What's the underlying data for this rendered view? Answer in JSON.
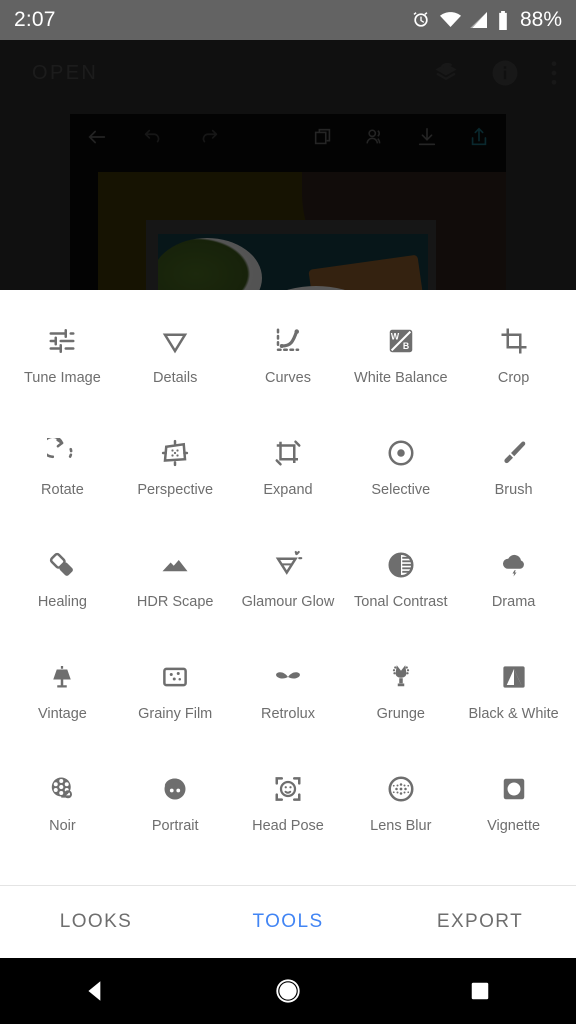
{
  "status_bar": {
    "time": "2:07",
    "battery_percent": "88%",
    "icons": [
      "alarm-icon",
      "wifi-icon",
      "cell-signal-icon",
      "battery-icon"
    ]
  },
  "app_bar": {
    "title": "OPEN",
    "icons": [
      "stack-layers-icon",
      "info-icon",
      "overflow-menu-icon"
    ]
  },
  "editor_toolbar": {
    "icons": [
      "back-arrow-icon",
      "undo-icon",
      "redo-icon",
      "stack-copies-icon",
      "portrait-people-icon",
      "download-icon",
      "share-export-icon"
    ]
  },
  "sheet": {
    "tools": [
      {
        "label": "Tune Image",
        "icon": "tune-sliders-icon"
      },
      {
        "label": "Details",
        "icon": "details-triangle-icon"
      },
      {
        "label": "Curves",
        "icon": "curves-icon"
      },
      {
        "label": "White Balance",
        "icon": "white-balance-icon"
      },
      {
        "label": "Crop",
        "icon": "crop-icon"
      },
      {
        "label": "Rotate",
        "icon": "rotate-icon"
      },
      {
        "label": "Perspective",
        "icon": "perspective-icon"
      },
      {
        "label": "Expand",
        "icon": "expand-icon"
      },
      {
        "label": "Selective",
        "icon": "selective-target-icon"
      },
      {
        "label": "Brush",
        "icon": "brush-icon"
      },
      {
        "label": "Healing",
        "icon": "healing-bandage-icon"
      },
      {
        "label": "HDR Scape",
        "icon": "hdr-mountains-icon"
      },
      {
        "label": "Glamour Glow",
        "icon": "glamour-glow-icon"
      },
      {
        "label": "Tonal Contrast",
        "icon": "tonal-contrast-icon"
      },
      {
        "label": "Drama",
        "icon": "drama-cloud-icon"
      },
      {
        "label": "Vintage",
        "icon": "vintage-lamp-icon"
      },
      {
        "label": "Grainy Film",
        "icon": "grainy-film-icon"
      },
      {
        "label": "Retrolux",
        "icon": "retrolux-mustache-icon"
      },
      {
        "label": "Grunge",
        "icon": "grunge-guitar-icon"
      },
      {
        "label": "Black & White",
        "icon": "black-and-white-icon"
      },
      {
        "label": "Noir",
        "icon": "noir-film-reel-icon"
      },
      {
        "label": "Portrait",
        "icon": "portrait-face-icon"
      },
      {
        "label": "Head Pose",
        "icon": "head-pose-icon"
      },
      {
        "label": "Lens Blur",
        "icon": "lens-blur-icon"
      },
      {
        "label": "Vignette",
        "icon": "vignette-icon"
      }
    ]
  },
  "tab_bar": {
    "tabs": [
      {
        "label": "LOOKS",
        "active": false
      },
      {
        "label": "TOOLS",
        "active": true
      },
      {
        "label": "EXPORT",
        "active": false
      }
    ],
    "active_color": "#4285f4",
    "inactive_color": "#6e6e6e"
  },
  "nav_bar": {
    "buttons": [
      "back-triangle-icon",
      "home-circle-icon",
      "recents-square-icon"
    ]
  },
  "colors": {
    "status_bar_bg": "#636363",
    "app_bg_dim": "#2b2b2b",
    "sheet_bg": "#ffffff",
    "icon_gray": "#6e6e6e",
    "accent_blue": "#4285f4"
  }
}
